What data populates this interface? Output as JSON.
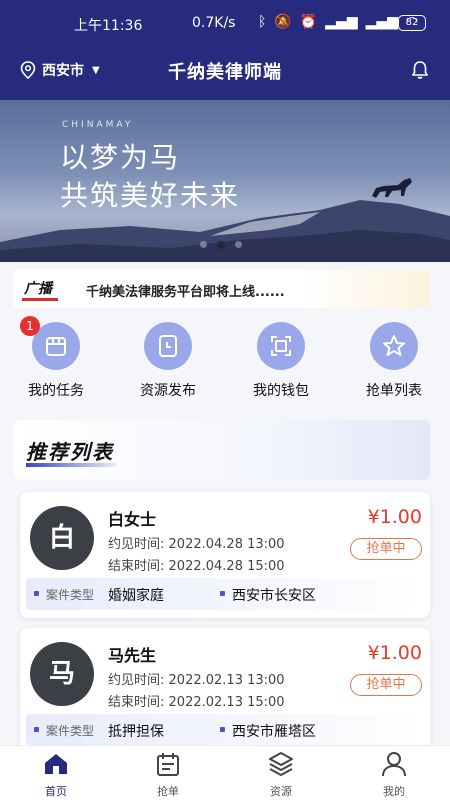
{
  "status_bar": {
    "time": "上午11:36",
    "network_speed": "0.7K/s",
    "battery": "82"
  },
  "header": {
    "city": "西安市",
    "title": "千纳美律师端"
  },
  "banner": {
    "brand": "CHINAMAY",
    "line1": "以梦为马",
    "line2": "共筑美好未来",
    "active_dot": 2
  },
  "broadcast": {
    "tag": "广播",
    "text": "千纳美法律服务平台即将上线......"
  },
  "quick_actions": [
    {
      "label": "我的任务",
      "icon": "task-icon",
      "badge": "1"
    },
    {
      "label": "资源发布",
      "icon": "publish-icon"
    },
    {
      "label": "我的钱包",
      "icon": "wallet-icon"
    },
    {
      "label": "抢单列表",
      "icon": "star-icon"
    }
  ],
  "recommend": {
    "title": "推荐列表",
    "cards": [
      {
        "avatar": "白",
        "name": "白女士",
        "appoint_label": "约见时间:",
        "appoint_time": "2022.04.28 13:00",
        "end_label": "结束时间:",
        "end_time": "2022.04.28 15:00",
        "price": "¥1.00",
        "status": "抢单中",
        "case_type_label": "案件类型",
        "case_type": "婚姻家庭",
        "location": "西安市长安区"
      },
      {
        "avatar": "马",
        "name": "马先生",
        "appoint_label": "约见时间:",
        "appoint_time": "2022.02.13 13:00",
        "end_label": "结束时间:",
        "end_time": "2022.02.13 15:00",
        "price": "¥1.00",
        "status": "抢单中",
        "case_type_label": "案件类型",
        "case_type": "抵押担保",
        "location": "西安市雁塔区"
      }
    ]
  },
  "bottom_nav": [
    {
      "label": "首页",
      "icon": "home-icon",
      "active": true
    },
    {
      "label": "抢单",
      "icon": "calendar-icon"
    },
    {
      "label": "资源",
      "icon": "layers-icon"
    },
    {
      "label": "我的",
      "icon": "user-icon"
    }
  ],
  "colors": {
    "primary": "#262b7d",
    "accent_red": "#e23b2a",
    "status_orange": "#e8754a",
    "icon_circle": "#9aa8ea"
  }
}
